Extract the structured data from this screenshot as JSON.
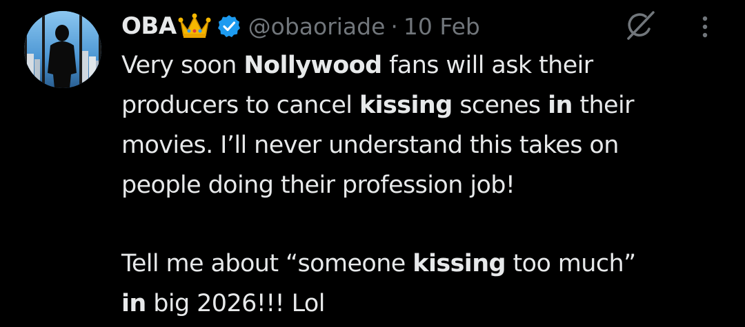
{
  "post": {
    "author": {
      "display_name": "OBA",
      "handle": "@obaoriade",
      "verified": true,
      "avatar_icon": "avatar-silhouette-window",
      "name_emoji": "crown-icon"
    },
    "separator": "·",
    "date": "10 Feb",
    "lines": [
      [
        {
          "text": "Very soon ",
          "bold": false
        },
        {
          "text": "Nollywood",
          "bold": true
        },
        {
          "text": " fans will ask their",
          "bold": false
        }
      ],
      [
        {
          "text": "producers to cancel ",
          "bold": false
        },
        {
          "text": "kissing",
          "bold": true
        },
        {
          "text": " scenes ",
          "bold": false
        },
        {
          "text": "in",
          "bold": true
        },
        {
          "text": " their",
          "bold": false
        }
      ],
      [
        {
          "text": "movies. I’ll never understand this takes on",
          "bold": false
        }
      ],
      [
        {
          "text": "people doing their profession job!",
          "bold": false
        }
      ],
      [],
      [
        {
          "text": "Tell me about “someone ",
          "bold": false
        },
        {
          "text": "kissing",
          "bold": true
        },
        {
          "text": " too much”",
          "bold": false
        }
      ],
      [
        {
          "text": "in",
          "bold": true
        },
        {
          "text": " big 2026!!! Lol",
          "bold": false
        }
      ]
    ]
  },
  "icons": {
    "grok": "grok-icon",
    "more": "more-options-icon"
  },
  "colors": {
    "background": "#000000",
    "text": "#e7e9ea",
    "secondary": "#71767b",
    "verified": "#1d9bf0"
  }
}
